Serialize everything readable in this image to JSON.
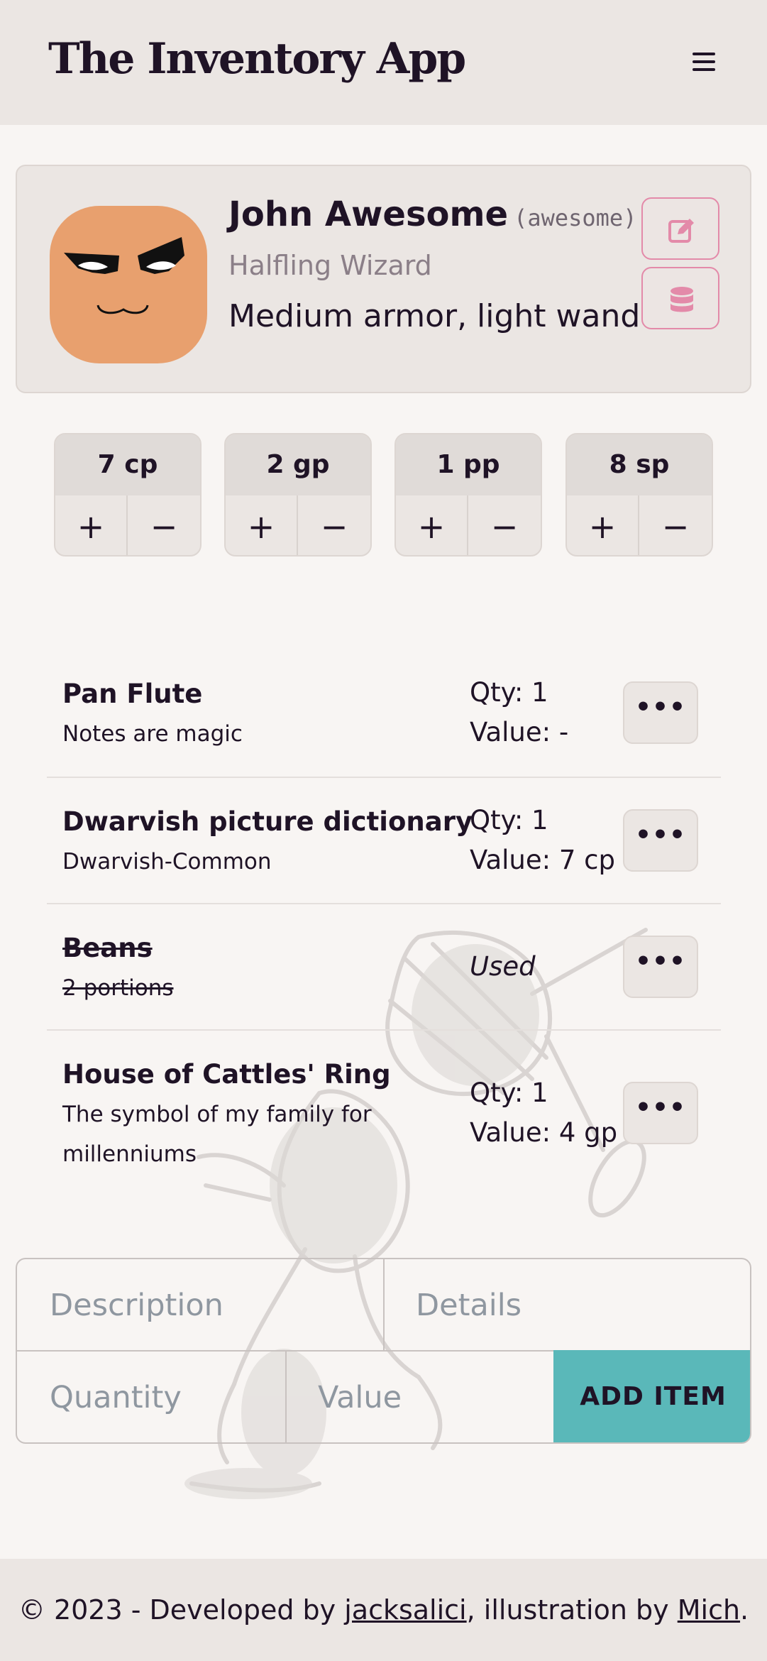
{
  "header": {
    "title": "The Inventory App",
    "menu_icon": "hamburger-menu-icon"
  },
  "character": {
    "name": "John Awesome",
    "nickname": "(awesome)",
    "race_class": "Halfling Wizard",
    "gear": "Medium armor, light wand",
    "avatar_color": "#e8a06e",
    "edit_icon": "edit-icon",
    "database_icon": "database-icon",
    "accent_color": "#e38aa9"
  },
  "coins": [
    {
      "value": "7 cp",
      "plus": "+",
      "minus": "−"
    },
    {
      "value": "2 gp",
      "plus": "+",
      "minus": "−"
    },
    {
      "value": "1 pp",
      "plus": "+",
      "minus": "−"
    },
    {
      "value": "8 sp",
      "plus": "+",
      "minus": "−"
    }
  ],
  "items": [
    {
      "name": "Pan Flute",
      "description": "Notes are magic",
      "qty": "Qty: 1",
      "value": "Value: -",
      "menu": "•••"
    },
    {
      "name": "Dwarvish picture dictionary",
      "description": "Dwarvish-Common",
      "qty": "Qty: 1",
      "value": "Value: 7 cp",
      "menu": "•••"
    },
    {
      "name": "Beans",
      "description": "2 portions",
      "status": "Used",
      "menu": "•••"
    },
    {
      "name": "House of Cattles' Ring",
      "description": "The symbol of my family for millenniums",
      "qty": "Qty: 1",
      "value": "Value: 4 gp",
      "menu": "•••"
    }
  ],
  "form": {
    "description_placeholder": "Description",
    "details_placeholder": "Details",
    "quantity_placeholder": "Quantity",
    "value_placeholder": "Value",
    "add_label": "ADD ITEM",
    "add_color": "#5ab8b9"
  },
  "footer": {
    "prefix": "© 2023 - Developed by ",
    "developer": "jacksalici",
    "middle": ", illustration by ",
    "illustrator": "Mich",
    "suffix": "."
  }
}
